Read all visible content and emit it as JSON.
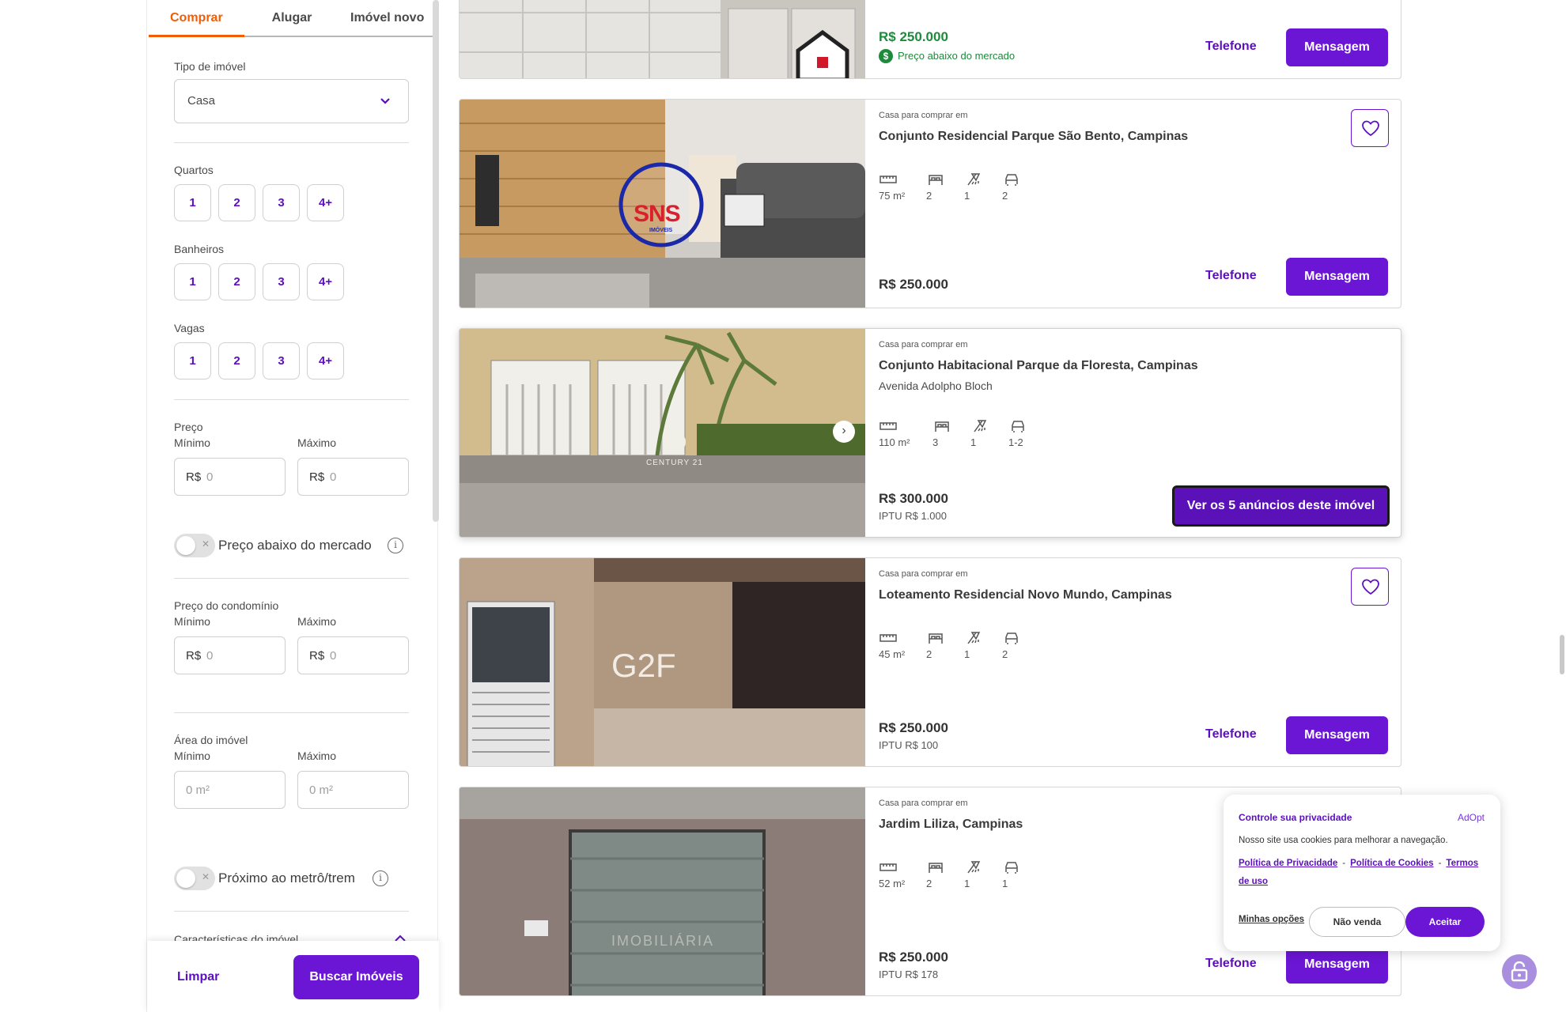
{
  "sidebar": {
    "tabs": [
      "Comprar",
      "Alugar",
      "Imóvel novo"
    ],
    "tipo_label": "Tipo de imóvel",
    "tipo_value": "Casa",
    "quartos_label": "Quartos",
    "banheiros_label": "Banheiros",
    "vagas_label": "Vagas",
    "chip_options": [
      "1",
      "2",
      "3",
      "4+"
    ],
    "preco_label": "Preço",
    "min_label": "Mínimo",
    "max_label": "Máximo",
    "currency_prefix": "R$",
    "zero_placeholder": "0",
    "abaixo_label": "Preço abaixo do mercado",
    "condominio_label": "Preço do condomínio",
    "area_label": "Área do imóvel",
    "area_placeholder": "0 m²",
    "metro_label": "Próximo ao metrô/trem",
    "caracteristicas_label": "Características do imóvel",
    "limpar_label": "Limpar",
    "buscar_label": "Buscar Imóveis"
  },
  "listings": [
    {
      "price": "R$ 250.000",
      "badge": "Preço abaixo do mercado",
      "telefone": "Telefone",
      "mensagem": "Mensagem"
    },
    {
      "kind": "Casa para comprar em",
      "title": "Conjunto Residencial Parque São Bento, Campinas",
      "features": [
        "75 m²",
        "2",
        "1",
        "2"
      ],
      "price": "R$ 250.000",
      "telefone": "Telefone",
      "mensagem": "Mensagem",
      "photo_logo": "SNS",
      "photo_logo_sub": "IMÓVEIS"
    },
    {
      "kind": "Casa para comprar em",
      "title": "Conjunto Habitacional Parque da Floresta, Campinas",
      "street": "Avenida Adolpho Bloch",
      "features": [
        "110 m²",
        "3",
        "1",
        "1-2"
      ],
      "price": "R$ 300.000",
      "iptu": "IPTU R$ 1.000",
      "cta": "Ver os 5 anúncios deste imóvel",
      "photo_logo": "21",
      "photo_logo_sub": "CENTURY 21"
    },
    {
      "kind": "Casa para comprar em",
      "title": "Loteamento Residencial Novo Mundo, Campinas",
      "features": [
        "45 m²",
        "2",
        "1",
        "2"
      ],
      "price": "R$ 250.000",
      "iptu": "IPTU R$ 100",
      "telefone": "Telefone",
      "mensagem": "Mensagem",
      "photo_logo": "G2F"
    },
    {
      "kind": "Casa para comprar em",
      "title": "Jardim Liliza, Campinas",
      "features": [
        "52 m²",
        "2",
        "1",
        "1"
      ],
      "price": "R$ 250.000",
      "iptu": "IPTU R$ 178",
      "telefone": "Telefone",
      "mensagem": "Mensagem",
      "photo_logo": "IMOBILIÁRIA"
    }
  ],
  "cookie": {
    "title": "Controle sua privacidade",
    "brand": "AdOpt",
    "desc": "Nosso site usa cookies para melhorar a navegação.",
    "link_privacy": "Política de Privacidade",
    "link_cookies": "Política de Cookies",
    "link_terms": "Termos de uso",
    "options": "Minhas opções",
    "nao_venda": "Não venda",
    "aceitar": "Aceitar"
  },
  "colors": {
    "accent": "#6b16d4",
    "tab_active": "#f25c05",
    "price_green": "#1e8a3c"
  }
}
